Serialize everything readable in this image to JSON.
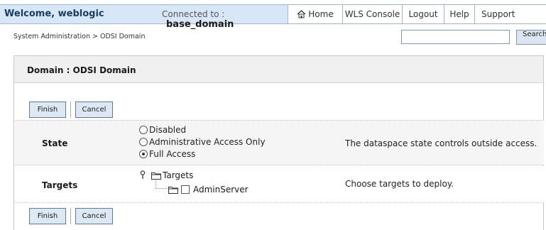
{
  "header": {
    "welcome": "Welcome, weblogic",
    "connected_label": "Connected to :",
    "domain_name": "base_domain",
    "nav": [
      {
        "label": "Home",
        "icon": "home-icon"
      },
      {
        "label": "WLS Console"
      },
      {
        "label": "Logout"
      },
      {
        "label": "Help"
      },
      {
        "label": "Support"
      }
    ]
  },
  "breadcrumb": "System Administration > ODSI Domain",
  "search": {
    "value": "",
    "button_label": "Search"
  },
  "panel": {
    "title": "Domain : ODSI Domain",
    "buttons": {
      "finish": "Finish",
      "cancel": "Cancel"
    },
    "state": {
      "label": "State",
      "options": [
        {
          "label": "Disabled",
          "selected": false
        },
        {
          "label": "Administrative Access Only",
          "selected": false
        },
        {
          "label": "Full Access",
          "selected": true
        }
      ],
      "help": "The dataspace state controls outside access."
    },
    "targets": {
      "label": "Targets",
      "tree_root": "Targets",
      "tree_child": "AdminServer",
      "help": "Choose targets to deploy."
    }
  }
}
